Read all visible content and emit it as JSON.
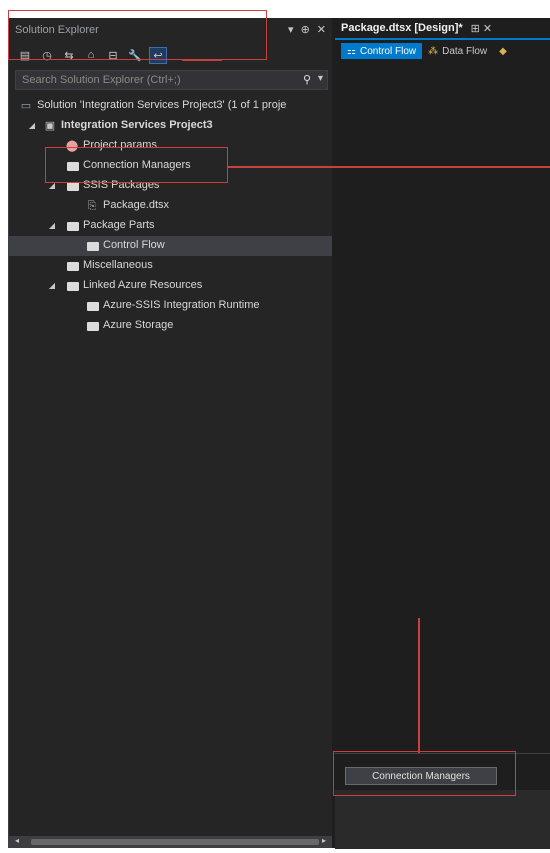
{
  "solution_explorer": {
    "title": "Solution Explorer",
    "title_controls": [
      "▾",
      "⊕",
      "✕"
    ],
    "search_placeholder": "Search Solution Explorer (Ctrl+;)",
    "tree": [
      {
        "label": "Solution 'Integration Services Project3' (1 of 1 proje",
        "icon": "solution-icon",
        "level": 0
      },
      {
        "label": "Integration Services Project3",
        "icon": "project-icon",
        "level": 1,
        "expanded": true,
        "bold": true
      },
      {
        "label": "Project.params",
        "icon": "params-icon",
        "level": 2
      },
      {
        "label": "Connection Managers",
        "icon": "folder-icon",
        "level": 2
      },
      {
        "label": "SSIS Packages",
        "icon": "folder-icon",
        "level": 2,
        "expanded": true
      },
      {
        "label": "Package.dtsx",
        "icon": "package-icon",
        "level": 3
      },
      {
        "label": "Package Parts",
        "icon": "folder-icon",
        "level": 2,
        "expanded": true
      },
      {
        "label": "Control Flow",
        "icon": "folder-icon",
        "level": 3,
        "selected": true
      },
      {
        "label": "Miscellaneous",
        "icon": "folder-icon",
        "level": 2
      },
      {
        "label": "Linked Azure Resources",
        "icon": "folder-icon",
        "level": 2,
        "expanded": true
      },
      {
        "label": "Azure-SSIS Integration Runtime",
        "icon": "folder-icon",
        "level": 3
      },
      {
        "label": "Azure Storage",
        "icon": "folder-icon",
        "level": 3
      }
    ]
  },
  "designer": {
    "document_tab": "Package.dtsx [Design]*",
    "tab_controls": "⊞ ✕",
    "tabs": [
      {
        "label": "Control Flow",
        "active": true
      },
      {
        "label": "Data Flow",
        "active": false
      }
    ],
    "connection_managers_tab": "Connection Managers"
  },
  "colors": {
    "accent": "#007acc",
    "annotation": "#c94040",
    "background": "#1e1e1e"
  }
}
